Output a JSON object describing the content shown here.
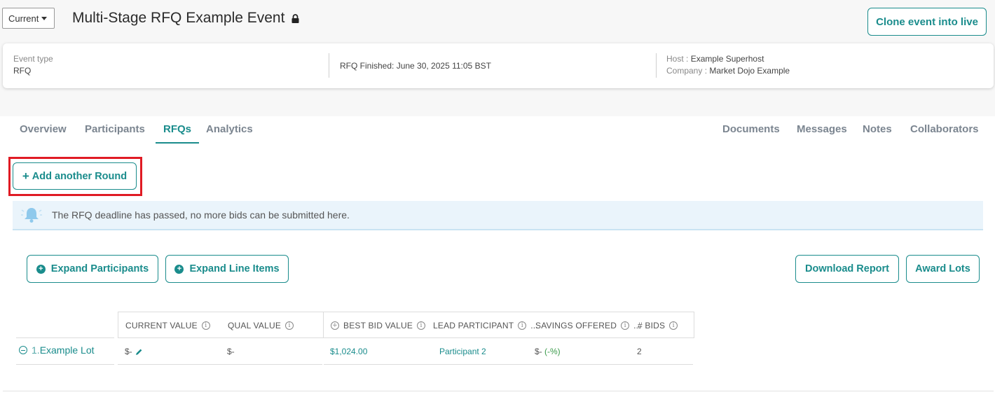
{
  "header": {
    "version_select": "Current",
    "event_title": "Multi-Stage RFQ Example Event",
    "clone_button": "Clone event into live"
  },
  "info": {
    "event_type_label": "Event type",
    "event_type_value": "RFQ",
    "rfq_status": "RFQ Finished: June 30, 2025 11:05 BST",
    "host_label": "Host :",
    "host_value": "Example Superhost",
    "company_label": "Company :",
    "company_value": "Market Dojo Example"
  },
  "tabs": {
    "left": [
      "Overview",
      "Participants",
      "RFQs",
      "Analytics"
    ],
    "right": [
      "Documents",
      "Messages",
      "Notes",
      "Collaborators"
    ],
    "active": "RFQs"
  },
  "actions": {
    "add_round": "Add another Round",
    "expand_participants": "Expand Participants",
    "expand_line_items": "Expand Line Items",
    "download_report": "Download Report",
    "award_lots": "Award Lots"
  },
  "notice": {
    "text": "The RFQ deadline has passed, no more bids can be submitted here."
  },
  "table": {
    "columns": [
      "CURRENT VALUE",
      "QUAL VALUE",
      "BEST BID VALUE",
      "LEAD PARTICIPANT",
      "SAVINGS OFFERED",
      "# BIDS"
    ],
    "lot": {
      "number": "1.",
      "name": "Example Lot",
      "current_value": "$-",
      "qual_value": "$-",
      "best_bid_value": "$1,024.00",
      "lead_participant": "Participant 2",
      "savings_prefix": "$-",
      "savings_pct": "(-%)",
      "bids": "2"
    }
  },
  "colors": {
    "accent": "#1a8c8c",
    "highlight": "#e01b24",
    "notice_bg": "#eaf4fb"
  }
}
